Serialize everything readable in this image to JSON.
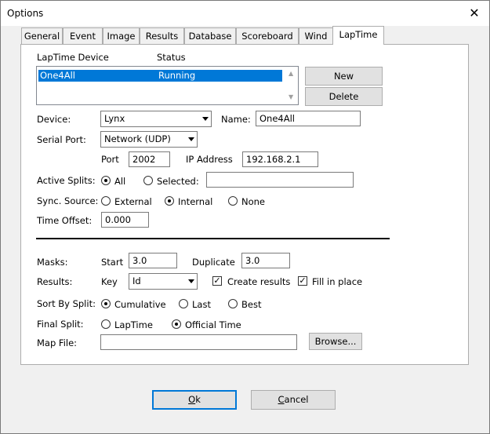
{
  "window": {
    "title": "Options",
    "close_glyph": "✕"
  },
  "tabs": [
    {
      "label": "General"
    },
    {
      "label": "Event"
    },
    {
      "label": "Image"
    },
    {
      "label": "Results"
    },
    {
      "label": "Database"
    },
    {
      "label": "Scoreboard"
    },
    {
      "label": "Wind"
    },
    {
      "label": "LapTime",
      "active": true
    }
  ],
  "laptime": {
    "device_list": {
      "col_device": "LapTime Device",
      "col_status": "Status",
      "rows": [
        {
          "device": "One4All",
          "status": "Running",
          "selected": true
        }
      ],
      "new_button": "New",
      "delete_button": "Delete"
    },
    "device": {
      "label": "Device:",
      "value": "Lynx"
    },
    "name": {
      "label": "Name:",
      "value": "One4All"
    },
    "serial_port": {
      "label": "Serial Port:",
      "value": "Network (UDP)"
    },
    "port": {
      "label": "Port",
      "value": "2002"
    },
    "ip_address": {
      "label": "IP Address",
      "value": "192.168.2.1"
    },
    "active_splits": {
      "label": "Active Splits:",
      "option_all": "All",
      "option_selected": "Selected:",
      "selected_option": "All",
      "selected_value": ""
    },
    "sync_source": {
      "label": "Sync. Source:",
      "option_external": "External",
      "option_internal": "Internal",
      "option_none": "None",
      "selected_option": "Internal"
    },
    "time_offset": {
      "label": "Time Offset:",
      "value": "0.000"
    },
    "masks": {
      "label": "Masks:",
      "start_label": "Start",
      "start_value": "3.0",
      "duplicate_label": "Duplicate",
      "duplicate_value": "3.0"
    },
    "results": {
      "label": "Results:",
      "key_label": "Key",
      "key_value": "Id",
      "create_results": "Create results",
      "create_results_checked": true,
      "fill_in_place": "Fill in place",
      "fill_in_place_checked": true
    },
    "sort_by_split": {
      "label": "Sort By Split:",
      "option_cumulative": "Cumulative",
      "option_last": "Last",
      "option_best": "Best",
      "selected_option": "Cumulative"
    },
    "final_split": {
      "label": "Final Split:",
      "option_laptime": "LapTime",
      "option_official": "Official Time",
      "selected_option": "Official Time"
    },
    "map_file": {
      "label": "Map File:",
      "value": "",
      "browse_button": "Browse..."
    }
  },
  "footer": {
    "ok_button": {
      "accel": "O",
      "rest": "k"
    },
    "cancel_button": {
      "accel": "C",
      "rest": "ancel"
    }
  }
}
